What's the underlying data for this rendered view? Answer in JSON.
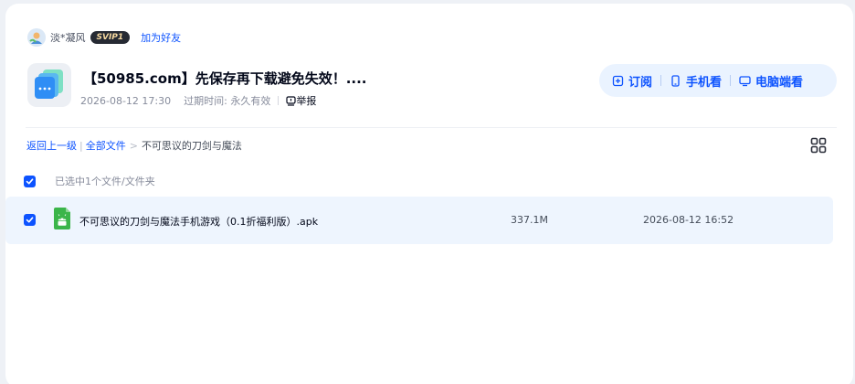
{
  "share": {
    "username": "淡*凝风",
    "vip_badge": "SVIP1",
    "add_friend_label": "加为好友",
    "title": "【50985.com】先保存再下载避免失效！....",
    "created_time": "2026-08-12 17:30",
    "expire_label": "过期时间: 永久有效",
    "report_label": "举报"
  },
  "actions": {
    "subscribe_label": "订阅",
    "phone_label": "手机看",
    "pc_label": "电脑端看"
  },
  "breadcrumb": {
    "back_label": "返回上一级",
    "all_files_label": "全部文件",
    "separator": ">",
    "current_label": "不可思议的刀剑与魔法"
  },
  "selection": {
    "text": "已选中1个文件/文件夹"
  },
  "files": [
    {
      "name": "不可思议的刀剑与魔法手机游戏（0.1折福利版）.apk",
      "size": "337.1M",
      "date": "2026-08-12 16:52",
      "type_icon": "android-apk-icon",
      "checked": true
    }
  ],
  "colors": {
    "accent": "#0d53ff",
    "apk_green": "#3bb54a",
    "row_selected": "#eef5fe",
    "action_bg": "#eaf3ff"
  }
}
